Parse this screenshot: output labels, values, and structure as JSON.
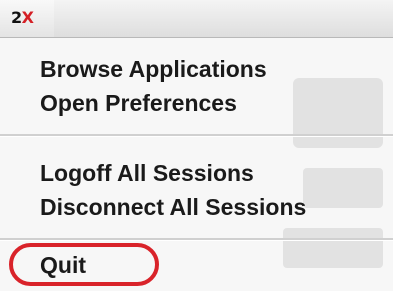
{
  "app": {
    "logo_prefix": "2",
    "logo_suffix": "X"
  },
  "menu": {
    "groups": [
      [
        "Browse Applications",
        "Open Preferences"
      ],
      [
        "Logoff All Sessions",
        "Disconnect All Sessions"
      ],
      [
        "Quit"
      ]
    ],
    "items": {
      "browse_applications": "Browse Applications",
      "open_preferences": "Open Preferences",
      "logoff_all_sessions": "Logoff All Sessions",
      "disconnect_all_sessions": "Disconnect All Sessions",
      "quit": "Quit"
    },
    "highlighted_item": "quit"
  },
  "colors": {
    "highlight_ring": "#d9232a",
    "logo_accent": "#d41f25",
    "menu_background": "#f7f7f7"
  }
}
